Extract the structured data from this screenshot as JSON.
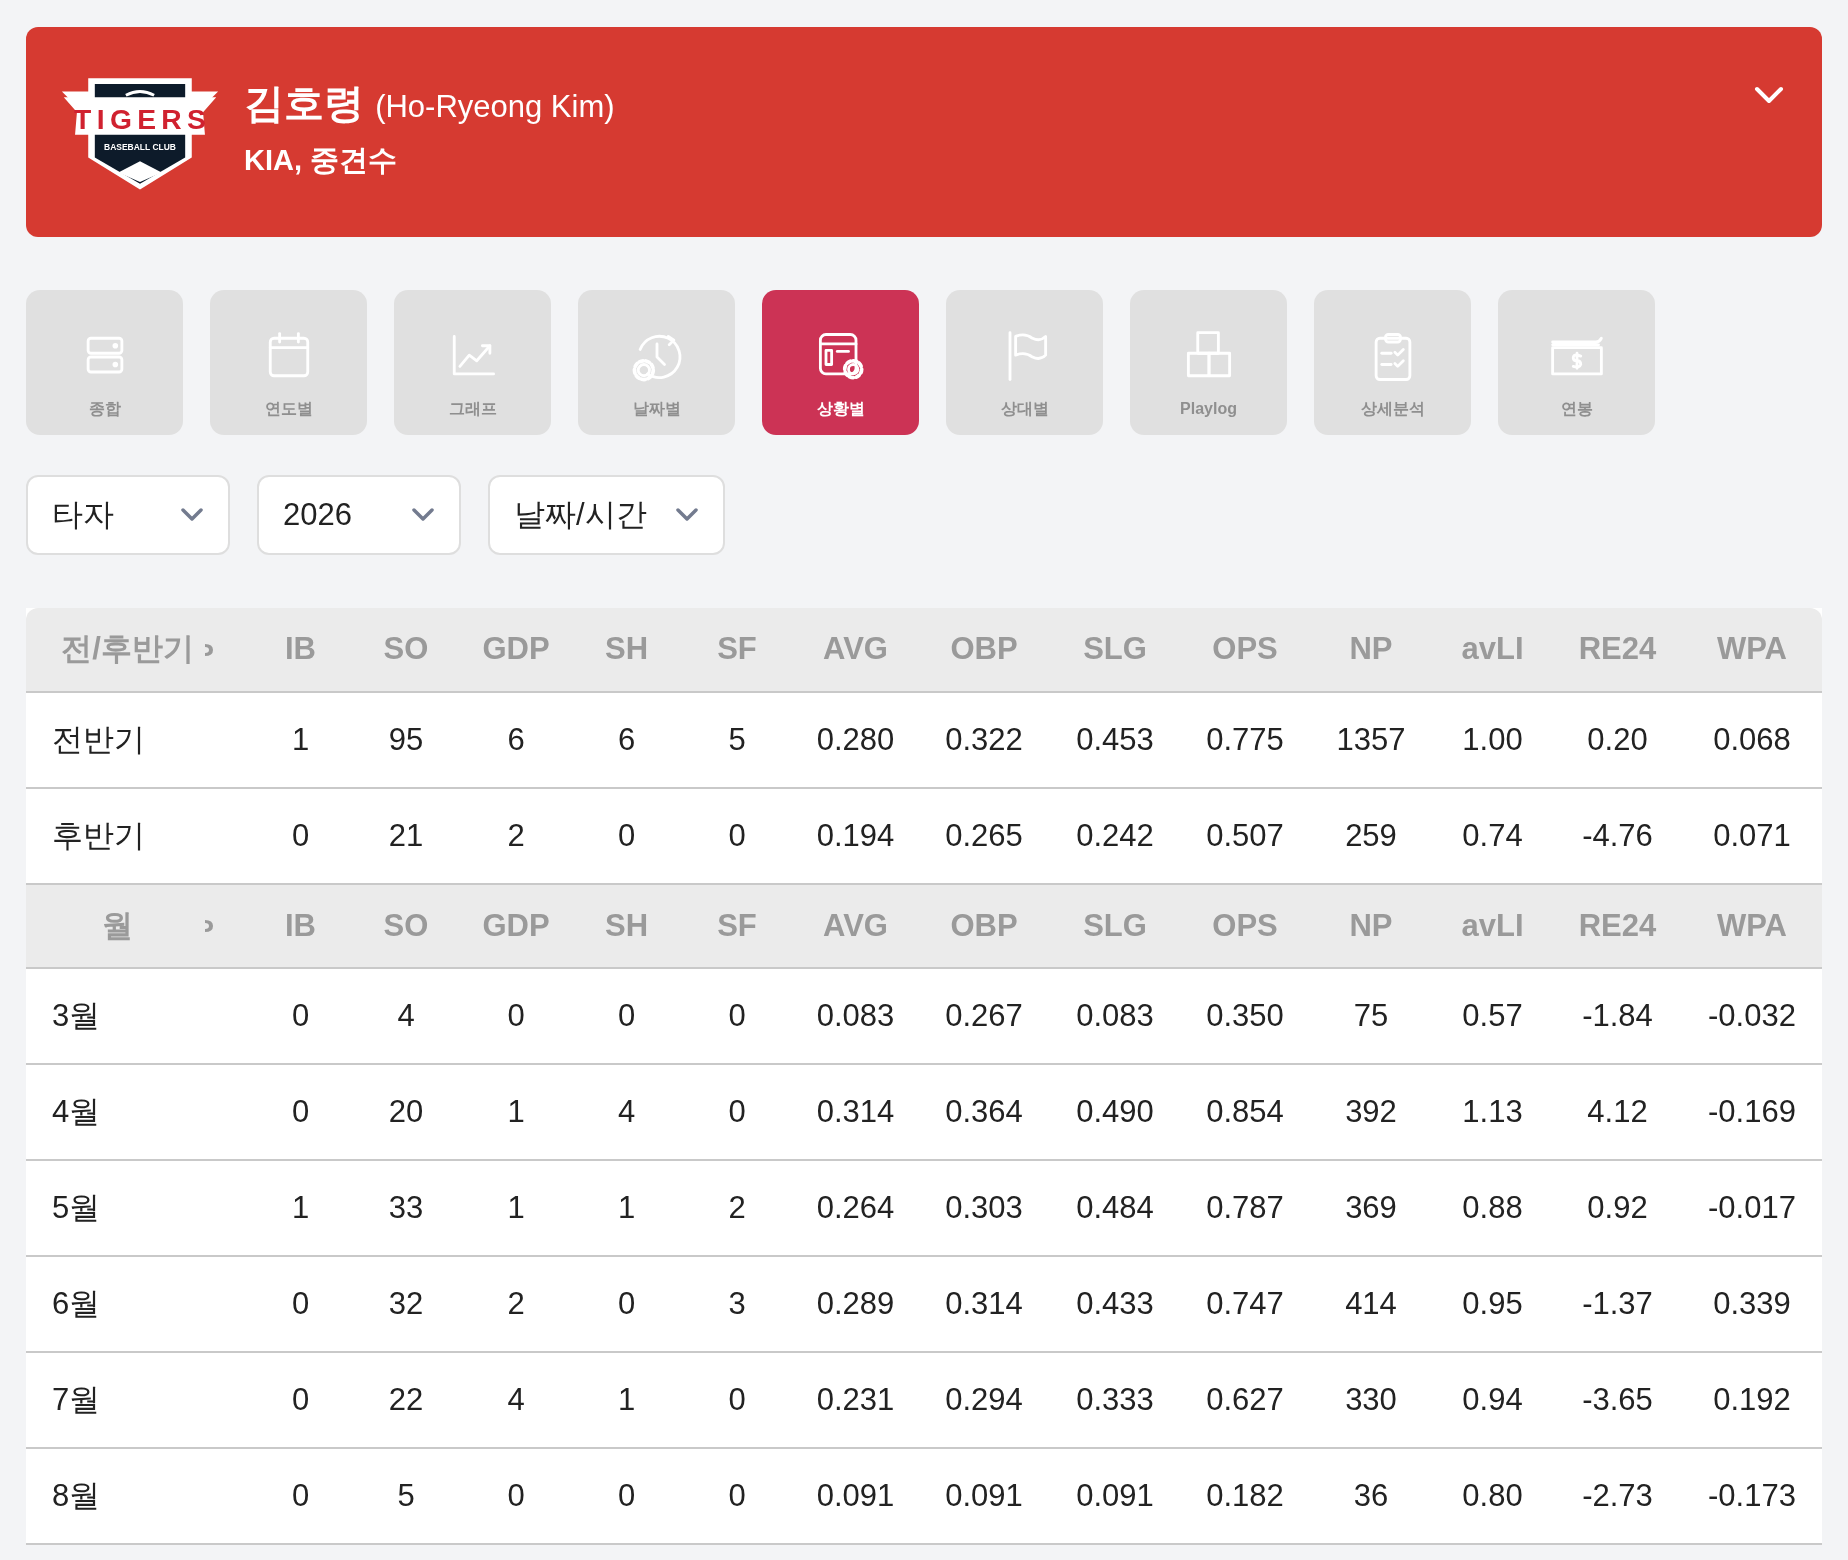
{
  "header": {
    "logo": {
      "wordmark": "TIGERS",
      "tagline": "BASEBALL CLUB"
    },
    "name": "김호령",
    "name_en": "(Ho-Ryeong Kim)",
    "subtitle": "KIA, 중견수"
  },
  "tabs": [
    {
      "label": "종합",
      "kind": "summary",
      "selected": false
    },
    {
      "label": "연도별",
      "kind": "yearly",
      "selected": false
    },
    {
      "label": "그래프",
      "kind": "graph",
      "selected": false
    },
    {
      "label": "날짜별",
      "kind": "date",
      "selected": false
    },
    {
      "label": "상황별",
      "kind": "situation",
      "selected": true
    },
    {
      "label": "상대별",
      "kind": "opponent",
      "selected": false
    },
    {
      "label": "Playlog",
      "kind": "playlog",
      "selected": false
    },
    {
      "label": "상세분석",
      "kind": "analysis",
      "selected": false
    },
    {
      "label": "연봉",
      "kind": "salary",
      "selected": false
    }
  ],
  "filters": [
    {
      "value": "타자"
    },
    {
      "value": "2026"
    },
    {
      "value": "날짜/시간"
    }
  ],
  "table": {
    "sections": [
      {
        "kind": "halves",
        "columns": [
          "전/후반기",
          "IB",
          "SO",
          "GDP",
          "SH",
          "SF",
          "AVG",
          "OBP",
          "SLG",
          "OPS",
          "NP",
          "avLI",
          "RE24",
          "WPA"
        ],
        "rows": [
          [
            "전반기",
            "1",
            "95",
            "6",
            "6",
            "5",
            "0.280",
            "0.322",
            "0.453",
            "0.775",
            "1357",
            "1.00",
            "0.20",
            "0.068"
          ],
          [
            "후반기",
            "0",
            "21",
            "2",
            "0",
            "0",
            "0.194",
            "0.265",
            "0.242",
            "0.507",
            "259",
            "0.74",
            "-4.76",
            "0.071"
          ]
        ]
      },
      {
        "kind": "months",
        "columns": [
          "월",
          "IB",
          "SO",
          "GDP",
          "SH",
          "SF",
          "AVG",
          "OBP",
          "SLG",
          "OPS",
          "NP",
          "avLI",
          "RE24",
          "WPA"
        ],
        "rows": [
          [
            "3월",
            "0",
            "4",
            "0",
            "0",
            "0",
            "0.083",
            "0.267",
            "0.083",
            "0.350",
            "75",
            "0.57",
            "-1.84",
            "-0.032"
          ],
          [
            "4월",
            "0",
            "20",
            "1",
            "4",
            "0",
            "0.314",
            "0.364",
            "0.490",
            "0.854",
            "392",
            "1.13",
            "4.12",
            "-0.169"
          ],
          [
            "5월",
            "1",
            "33",
            "1",
            "1",
            "2",
            "0.264",
            "0.303",
            "0.484",
            "0.787",
            "369",
            "0.88",
            "0.92",
            "-0.017"
          ],
          [
            "6월",
            "0",
            "32",
            "2",
            "0",
            "3",
            "0.289",
            "0.314",
            "0.433",
            "0.747",
            "414",
            "0.95",
            "-1.37",
            "0.339"
          ],
          [
            "7월",
            "0",
            "22",
            "4",
            "1",
            "0",
            "0.231",
            "0.294",
            "0.333",
            "0.627",
            "330",
            "0.94",
            "-3.65",
            "0.192"
          ],
          [
            "8월",
            "0",
            "5",
            "0",
            "0",
            "0",
            "0.091",
            "0.091",
            "0.091",
            "0.182",
            "36",
            "0.80",
            "-2.73",
            "-0.173"
          ]
        ]
      }
    ]
  }
}
